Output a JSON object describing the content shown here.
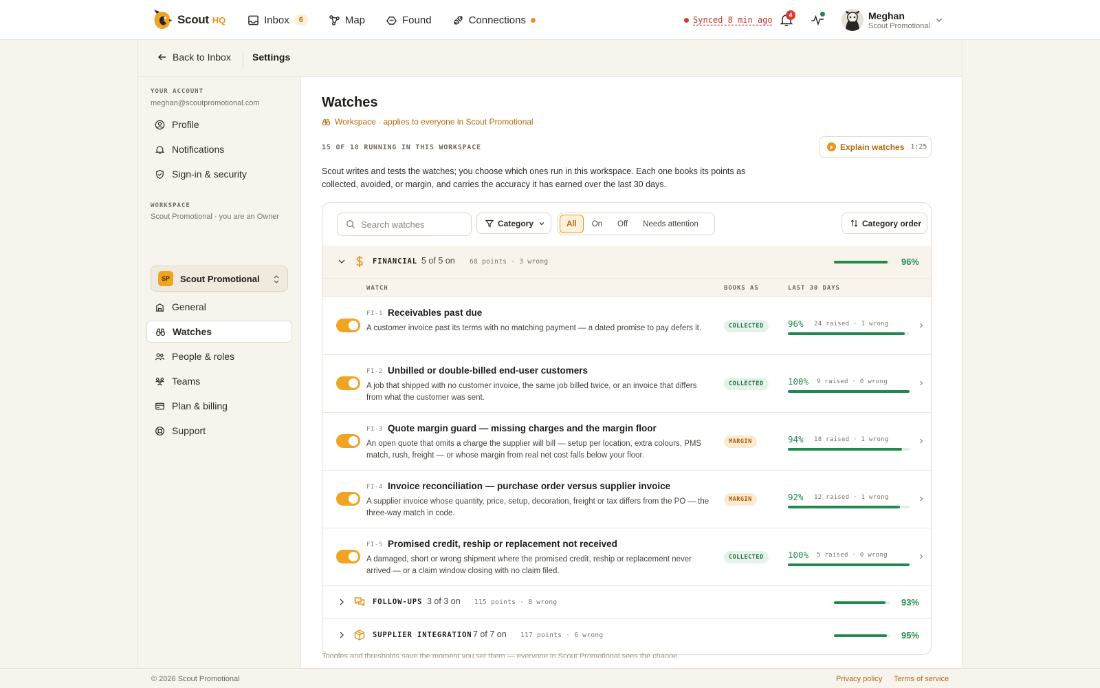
{
  "brand": {
    "name": "Scout",
    "suffix": "HQ"
  },
  "nav": {
    "inbox": {
      "label": "Inbox",
      "count": "6"
    },
    "map": {
      "label": "Map"
    },
    "found": {
      "label": "Found"
    },
    "connections": {
      "label": "Connections"
    }
  },
  "sync": {
    "text": "Synced 8 min ago"
  },
  "notifications": {
    "count": "4"
  },
  "user": {
    "name": "Meghan",
    "org": "Scout Promotional"
  },
  "subbar": {
    "back_label": "Back to Inbox",
    "title": "Settings"
  },
  "sidebar": {
    "account_label": "YOUR ACCOUNT",
    "email": "meghan@scoutpromotional.com",
    "account_items": [
      {
        "label": "Profile",
        "icon": "user-circle-icon"
      },
      {
        "label": "Notifications",
        "icon": "bell-icon"
      },
      {
        "label": "Sign-in & security",
        "icon": "shield-icon"
      }
    ],
    "workspace_label": "WORKSPACE",
    "workspace_sub": "Scout Promotional · you are an Owner",
    "workspace": {
      "initials": "SP",
      "name": "Scout Promotional"
    },
    "workspace_items": [
      {
        "label": "General",
        "icon": "building-icon"
      },
      {
        "label": "Watches",
        "icon": "binoculars-icon",
        "active": true
      },
      {
        "label": "People & roles",
        "icon": "people-icon"
      },
      {
        "label": "Teams",
        "icon": "team-icon"
      },
      {
        "label": "Plan & billing",
        "icon": "card-icon"
      },
      {
        "label": "Support",
        "icon": "lifebuoy-icon"
      }
    ]
  },
  "page": {
    "title": "Watches",
    "scope": "Workspace · applies to everyone in Scout Promotional",
    "running": "15 OF 18 RUNNING IN THIS WORKSPACE",
    "explain_label": "Explain watches",
    "explain_duration": "1:25",
    "intro": "Scout writes and tests the watches; you choose which ones run in this workspace. Each one books its points as collected, avoided, or margin, and carries the accuracy it has earned over the last 30 days.",
    "footer_note": "Toggles and thresholds save the moment you set them — everyone in Scout Promotional sees the change."
  },
  "toolbar": {
    "search_placeholder": "Search watches",
    "category_label": "Category",
    "filters": [
      "All",
      "On",
      "Off",
      "Needs attention"
    ],
    "active_filter": "All",
    "order_label": "Category order"
  },
  "table_headers": {
    "watch": "WATCH",
    "books_as": "BOOKS AS",
    "last30": "LAST 30 DAYS"
  },
  "categories": [
    {
      "name": "FINANCIAL",
      "on": "5 of 5 on",
      "stats": "68 points · 3 wrong",
      "pct": "96%",
      "pct_value": 0.96,
      "expanded": true
    },
    {
      "name": "FOLLOW-UPS",
      "on": "3 of 3 on",
      "stats": "115 points · 8 wrong",
      "pct": "93%",
      "pct_value": 0.93,
      "expanded": false
    },
    {
      "name": "SUPPLIER INTEGRATION",
      "on": "7 of 7 on",
      "stats": "117 points · 6 wrong",
      "pct": "95%",
      "pct_value": 0.95,
      "expanded": false
    }
  ],
  "watches": [
    {
      "code": "FI-1",
      "title": "Receivables past due",
      "desc": "A customer invoice past its terms with no matching payment — a dated promise to pay defers it.",
      "books": "COLLECTED",
      "pct": "96%",
      "pct_value": 0.96,
      "stats": "24 raised · 1 wrong",
      "on": true
    },
    {
      "code": "FI-2",
      "title": "Unbilled or double-billed end-user customers",
      "desc": "A job that shipped with no customer invoice, the same job billed twice, or an invoice that differs from what the customer was sent.",
      "books": "COLLECTED",
      "pct": "100%",
      "pct_value": 1.0,
      "stats": "9 raised · 0 wrong",
      "on": true
    },
    {
      "code": "FI-3",
      "title": "Quote margin guard — missing charges and the margin floor",
      "desc": "An open quote that omits a charge the supplier will bill — setup per location, extra colours, PMS match, rush, freight — or whose margin from real net cost falls below your floor.",
      "books": "MARGIN",
      "pct": "94%",
      "pct_value": 0.94,
      "stats": "18 raised · 1 wrong",
      "on": true
    },
    {
      "code": "FI-4",
      "title": "Invoice reconciliation — purchase order versus supplier invoice",
      "desc": "A supplier invoice whose quantity, price, setup, decoration, freight or tax differs from the PO — the three-way match in code.",
      "books": "MARGIN",
      "pct": "92%",
      "pct_value": 0.92,
      "stats": "12 raised · 1 wrong",
      "on": true
    },
    {
      "code": "FI-5",
      "title": "Promised credit, reship or replacement not received",
      "desc": "A damaged, short or wrong shipment where the promised credit, reship or replacement never arrived — or a claim window closing with no claim filed.",
      "books": "COLLECTED",
      "pct": "100%",
      "pct_value": 1.0,
      "stats": "5 raised · 0 wrong",
      "on": true
    }
  ],
  "footer": {
    "copyright": "© 2026 Scout Promotional",
    "privacy": "Privacy policy",
    "terms": "Terms of service"
  },
  "colors": {
    "accent": "#e8951a",
    "success": "#1f8a4c",
    "danger": "#d8392d"
  }
}
